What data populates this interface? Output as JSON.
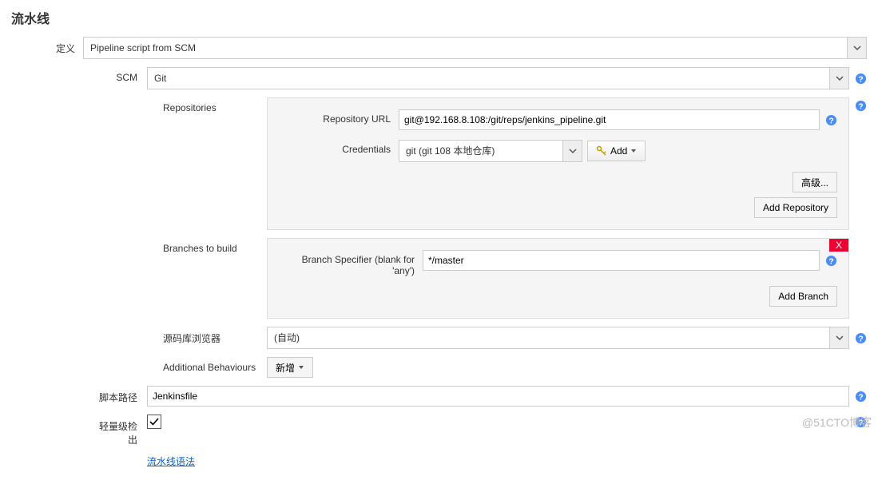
{
  "section_title": "流水线",
  "definition": {
    "label": "定义",
    "value": "Pipeline script from SCM"
  },
  "scm": {
    "label": "SCM",
    "value": "Git"
  },
  "repositories": {
    "label": "Repositories",
    "url_label": "Repository URL",
    "url_value": "git@192.168.8.108:/git/reps/jenkins_pipeline.git",
    "cred_label": "Credentials",
    "cred_value": "git (git 108 本地仓库)",
    "add_cred": "Add",
    "advanced_btn": "高级...",
    "add_repo_btn": "Add Repository"
  },
  "branches": {
    "label": "Branches to build",
    "spec_label": "Branch Specifier (blank for 'any')",
    "spec_value": "*/master",
    "delete": "X",
    "add_branch_btn": "Add Branch"
  },
  "browser": {
    "label": "源码库浏览器",
    "value": "(自动)"
  },
  "behaviours": {
    "label": "Additional Behaviours",
    "add_btn": "新增"
  },
  "script_path": {
    "label": "脚本路径",
    "value": "Jenkinsfile"
  },
  "lightweight": {
    "label": "轻量级检出",
    "checked": true
  },
  "syntax_link": "流水线语法",
  "watermark": "@51CTO博客"
}
